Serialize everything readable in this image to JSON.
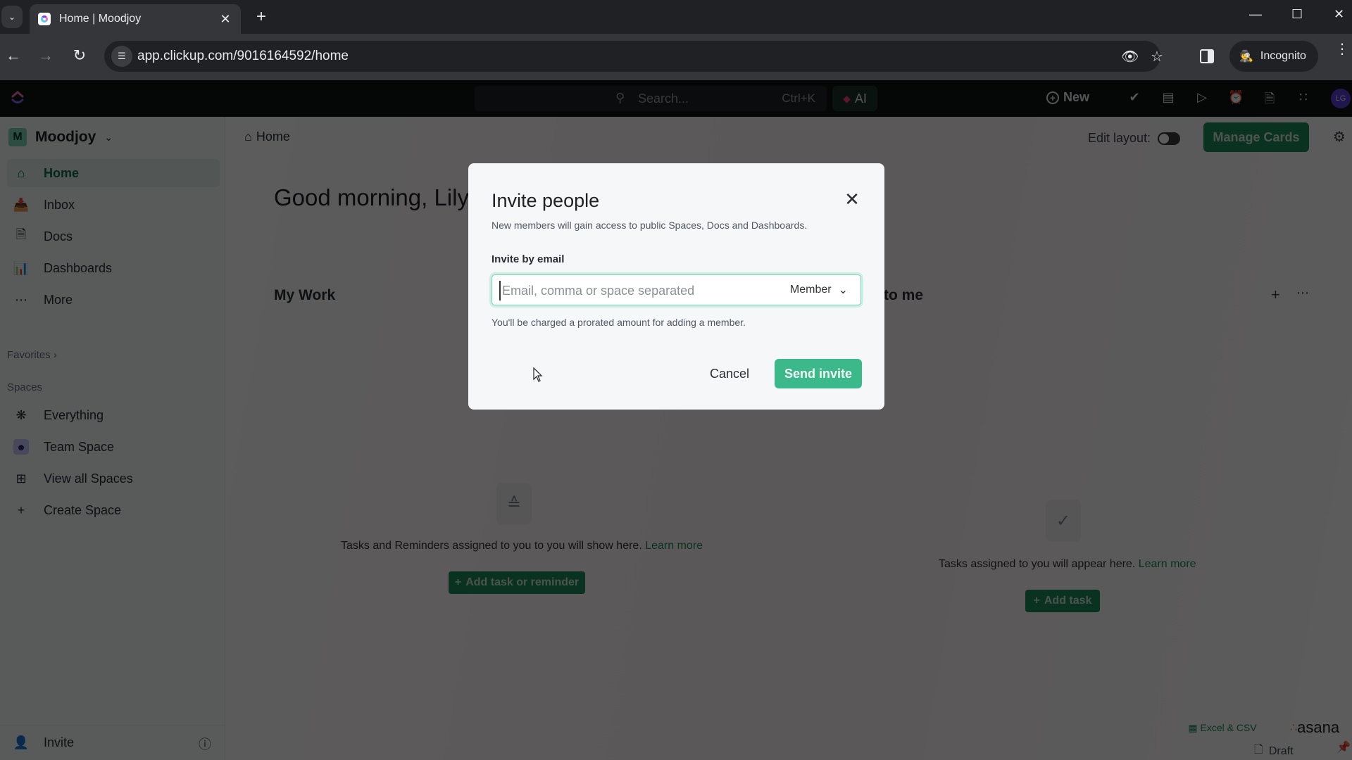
{
  "browser": {
    "tab_title": "Home | Moodjoy",
    "url": "app.clickup.com/9016164592/home",
    "incognito_label": "Incognito",
    "icons": {
      "tab_search": "chevron-down-icon",
      "new_tab": "plus-icon",
      "back": "arrow-left-icon",
      "forward": "arrow-right-icon",
      "reload": "reload-icon",
      "site_info": "tune-icon",
      "tracking": "eye-off-icon",
      "bookmark": "star-icon",
      "side_panel": "side-panel-icon",
      "menu": "kebab-menu-icon"
    }
  },
  "topbar": {
    "search_placeholder": "Search...",
    "search_shortcut": "Ctrl+K",
    "ai_label": "AI",
    "new_label": "New",
    "avatar_initials": "LG",
    "icons": [
      "check-circle-icon",
      "notepad-icon",
      "video-icon",
      "alarm-icon",
      "doc-icon",
      "apps-grid-icon"
    ]
  },
  "sidebar": {
    "workspace_initial": "M",
    "workspace_name": "Moodjoy",
    "nav": [
      {
        "label": "Home",
        "icon": "home-icon",
        "active": true
      },
      {
        "label": "Inbox",
        "icon": "inbox-icon",
        "active": false
      },
      {
        "label": "Docs",
        "icon": "doc-icon",
        "active": false
      },
      {
        "label": "Dashboards",
        "icon": "dashboard-icon",
        "active": false
      },
      {
        "label": "More",
        "icon": "more-icon",
        "active": false
      }
    ],
    "favorites_label": "Favorites",
    "spaces_label": "Spaces",
    "spaces": [
      {
        "label": "Everything",
        "icon": "everything-icon"
      },
      {
        "label": "Team Space",
        "icon": "team-icon"
      },
      {
        "label": "View all Spaces",
        "icon": "grid-icon"
      },
      {
        "label": "Create Space",
        "icon": "plus-icon"
      }
    ],
    "invite_label": "Invite"
  },
  "main": {
    "breadcrumb": "Home",
    "greeting": "Good morning, Lily",
    "edit_layout_label": "Edit layout:",
    "manage_cards_label": "Manage Cards",
    "my_work": {
      "title": "My Work",
      "empty_text": "Tasks and Reminders assigned to you to you will show here.",
      "learn_more": "Learn more",
      "button": "Add task or reminder"
    },
    "assigned": {
      "title": "to me",
      "empty_text": "Tasks assigned to you will appear here.",
      "learn_more": "Learn more",
      "button": "Add task"
    },
    "import_excel": "Excel & CSV",
    "import_asana": "asana",
    "draft_label": "Draft"
  },
  "modal": {
    "title": "Invite people",
    "subtitle": "New members will gain access to public Spaces, Docs and Dashboards.",
    "field_label": "Invite by email",
    "email_value": "",
    "email_placeholder": "Email, comma or space separated",
    "role_selected": "Member",
    "charge_note": "You'll be charged a prorated amount for adding a member.",
    "cancel_label": "Cancel",
    "send_label": "Send invite",
    "accent": "#3cb98a"
  }
}
